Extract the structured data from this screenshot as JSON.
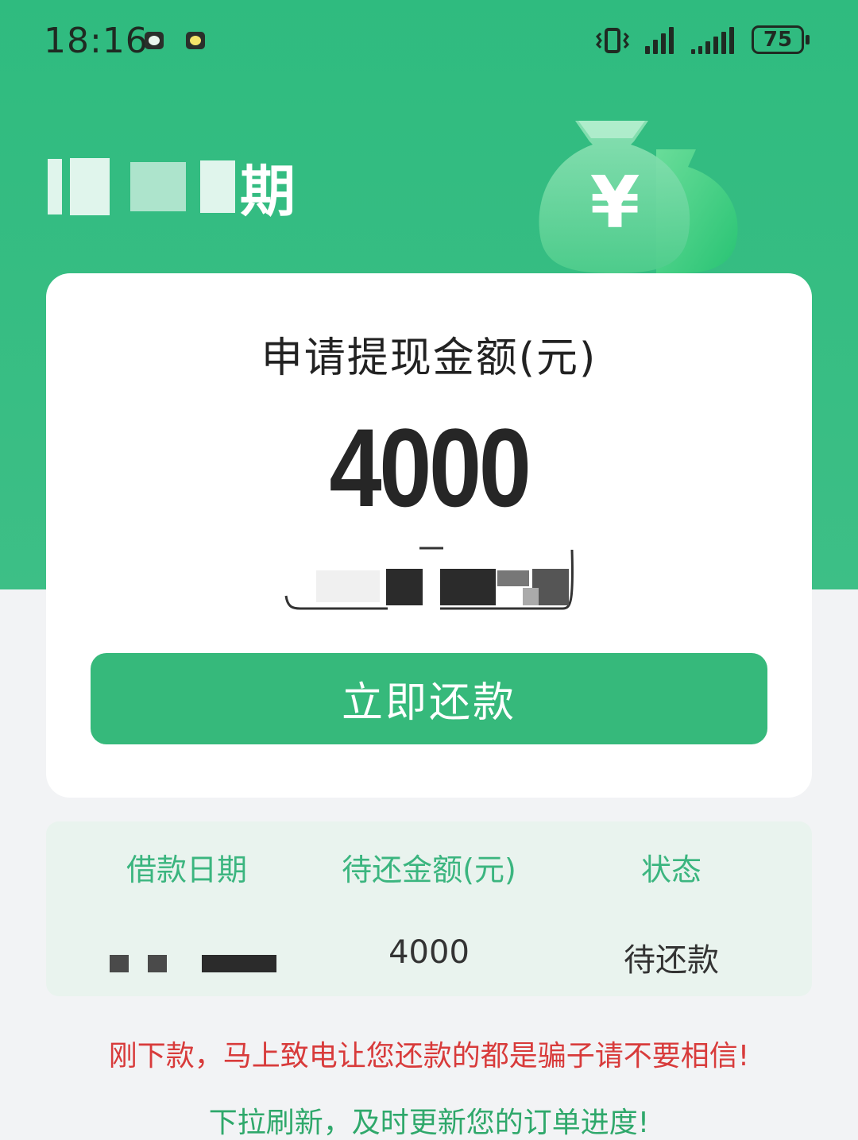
{
  "status_bar": {
    "time": "18:16",
    "battery": "75"
  },
  "brand": {
    "name_suffix": "期"
  },
  "card": {
    "title": "申请提现金额(元)",
    "amount": "4000",
    "button_label": "立即还款"
  },
  "table": {
    "headers": [
      "借款日期",
      "待还金额(元)",
      "状态"
    ],
    "row": {
      "amount": "4000",
      "status": "待还款"
    }
  },
  "notices": {
    "warning": "刚下款，马上致电让您还款的都是骗子请不要相信!",
    "tip": "下拉刷新，及时更新您的订单进度!"
  },
  "colors": {
    "primary_green": "#36b97b",
    "header_green": "#3bb57f",
    "warning_red": "#d83b3b",
    "tip_green": "#2fa86b"
  },
  "icons": [
    "moon-icon",
    "sun-icon",
    "vibrate-icon",
    "signal-icon",
    "battery-icon",
    "money-bag-icon"
  ]
}
